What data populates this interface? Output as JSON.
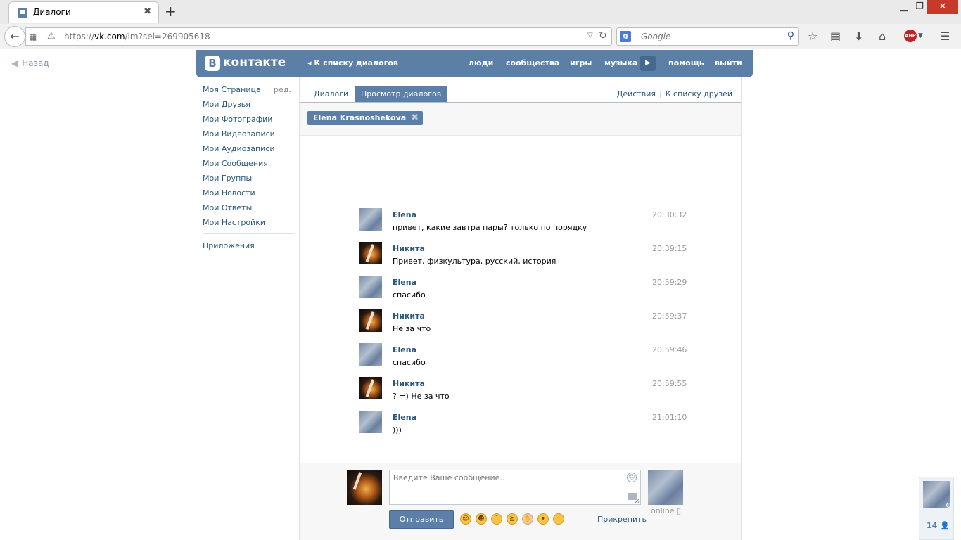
{
  "browser": {
    "tab_title": "Диалоги",
    "tab_close": "✖",
    "new_tab": "+",
    "url_prefix": "https://",
    "url_domain": "vk.com",
    "url_path": "/im?sel=269905618",
    "search_placeholder": "Google",
    "search_engine_letter": "g"
  },
  "page": {
    "back_label": "Назад",
    "header": {
      "logo_letter": "В",
      "logo_text": "контакте",
      "back_to_dialogs": "К списку диалогов",
      "nav": [
        "люди",
        "сообщества",
        "игры",
        "музыка",
        "помощь",
        "выйти"
      ]
    },
    "sidebar": {
      "edit_label": "ред.",
      "items": [
        "Моя Страница",
        "Мои Друзья",
        "Мои Фотографии",
        "Мои Видеозаписи",
        "Мои Аудиозаписи",
        "Мои Сообщения",
        "Мои Группы",
        "Мои Новости",
        "Мои Ответы",
        "Мои Настройки"
      ],
      "apps": "Приложения"
    },
    "tabs": {
      "dialogs": "Диалоги",
      "view_dialogs": "Просмотр диалогов",
      "actions": "Действия",
      "to_friends": "К списку друзей"
    },
    "recipient": "Elena Krasnoshekova",
    "messages": [
      {
        "author": "Elena",
        "text": "привет, какие завтра пары? только по порядку",
        "time": "20:30:32",
        "avatar": "elena"
      },
      {
        "author": "Никита",
        "text": "Привет, физкультура, русский, история",
        "time": "20:39:15",
        "avatar": "nikita"
      },
      {
        "author": "Elena",
        "text": "спасибо",
        "time": "20:59:29",
        "avatar": "elena"
      },
      {
        "author": "Никита",
        "text": "Не за что",
        "time": "20:59:37",
        "avatar": "nikita"
      },
      {
        "author": "Elena",
        "text": "спасибо",
        "time": "20:59:46",
        "avatar": "elena"
      },
      {
        "author": "Никита",
        "text": "? =) Не за что",
        "time": "20:59:55",
        "avatar": "nikita"
      },
      {
        "author": "Elena",
        "text": ")))",
        "time": "21:01:10",
        "avatar": "elena"
      }
    ],
    "composer": {
      "placeholder": "Введите Ваше сообщение..",
      "send": "Отправить",
      "attach": "Прикрепить",
      "online": "online"
    },
    "widget_count": "14"
  },
  "colors": {
    "vk_blue": "#5b7fa6",
    "link": "#2b587a"
  }
}
